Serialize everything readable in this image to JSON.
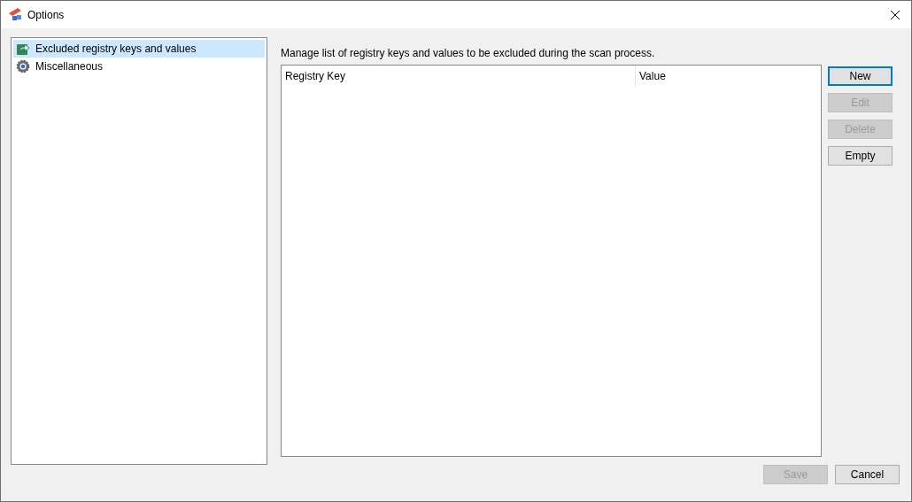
{
  "window": {
    "title": "Options"
  },
  "sidebar": {
    "items": [
      {
        "label": "Excluded registry keys and values",
        "kind": "share",
        "selected": true
      },
      {
        "label": "Miscellaneous",
        "kind": "gear",
        "selected": false
      }
    ]
  },
  "description": "Manage list of registry keys and values to be excluded during the scan process.",
  "table": {
    "columns": [
      "Registry Key",
      "Value"
    ]
  },
  "side_buttons": [
    {
      "label": "New",
      "disabled": false,
      "default": true
    },
    {
      "label": "Edit",
      "disabled": true,
      "default": false
    },
    {
      "label": "Delete",
      "disabled": true,
      "default": false
    },
    {
      "label": "Empty",
      "disabled": false,
      "default": false
    }
  ],
  "footer_buttons": [
    {
      "label": "Save",
      "disabled": true
    },
    {
      "label": "Cancel",
      "disabled": false
    }
  ]
}
